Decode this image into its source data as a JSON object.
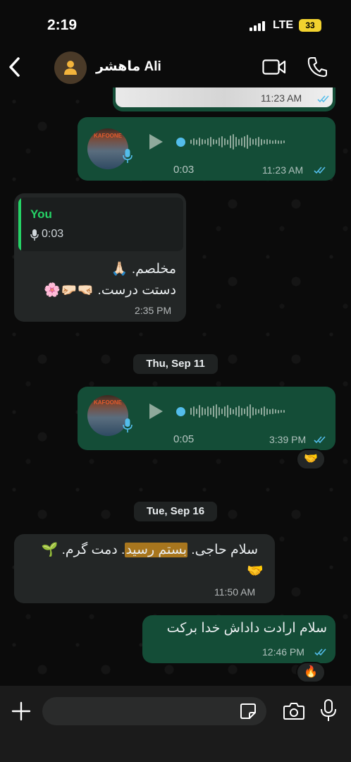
{
  "status_bar": {
    "time": "2:19",
    "network": "LTE",
    "battery": "33"
  },
  "header": {
    "contact_name": "ماهشر Ali"
  },
  "messages": {
    "image_msg": {
      "time": "11:23 AM"
    },
    "voice1": {
      "thumb_label": "KAFOONE",
      "duration": "0:03",
      "time": "11:23 AM"
    },
    "reply": {
      "quoted_author": "You",
      "quoted_duration": "0:03",
      "line1": "مخلصم. 🙏🏻",
      "line2": "دستت درست. 🤜🏻🤛🏻🌸",
      "time": "2:35 PM"
    },
    "date1": "Thu, Sep 11",
    "voice2": {
      "thumb_label": "KAFOONE",
      "duration": "0:05",
      "time": "3:39 PM",
      "reaction": "🤝"
    },
    "date2": "Tue, Sep 16",
    "incoming2": {
      "before": "سلام حاجی. ",
      "highlighted": "بستم رسید",
      "after": ". دمت گرم. 🌱",
      "line2": "🤝",
      "time": "11:50 AM"
    },
    "outgoing3": {
      "text": "سلام ارادت داداش خدا برکت",
      "time": "12:46 PM",
      "reaction": "🔥"
    }
  },
  "composer": {
    "placeholder": "",
    "value": ""
  },
  "colors": {
    "outgoing_bubble": "#144d37",
    "incoming_bubble": "#232626",
    "read_ticks": "#53bdeb",
    "accent_green": "#25d366"
  }
}
